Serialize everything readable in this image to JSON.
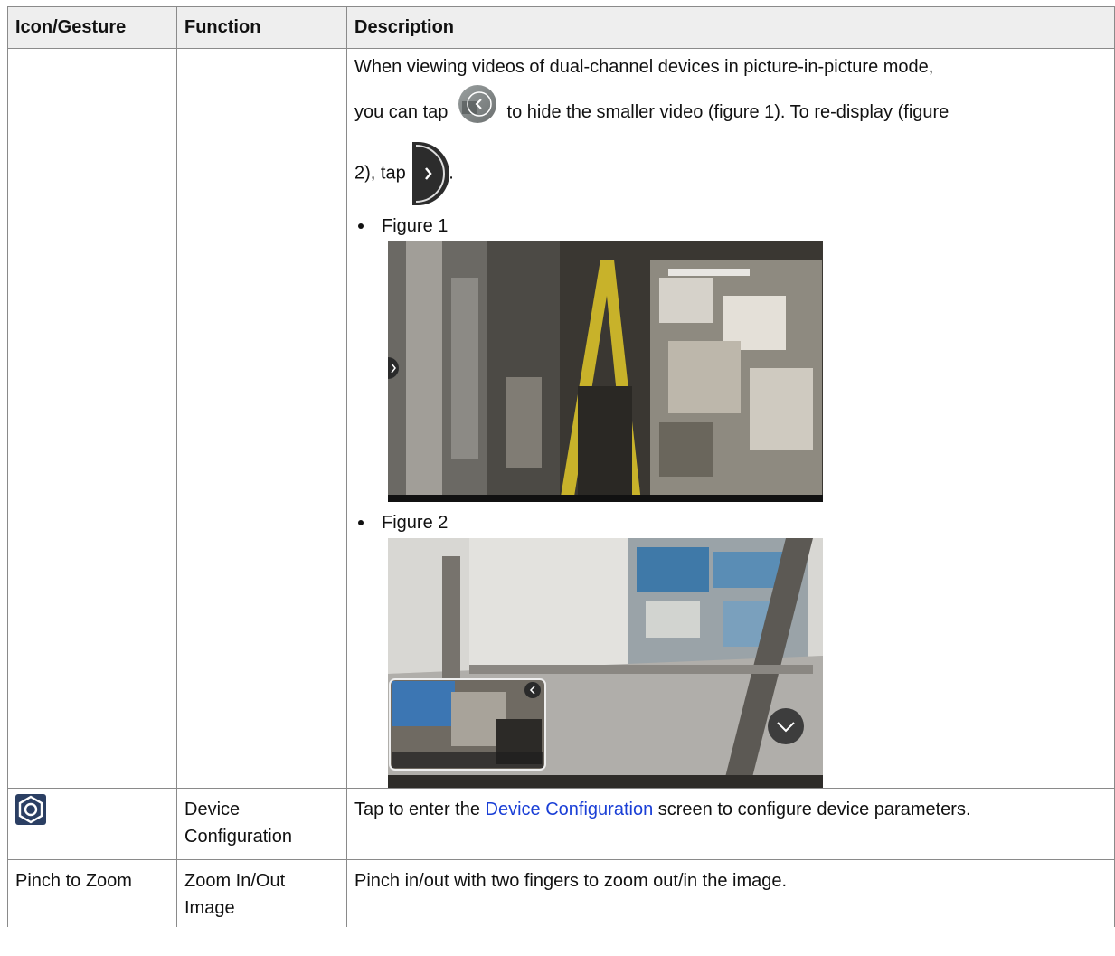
{
  "headers": {
    "col1": "Icon/Gesture",
    "col2": "Function",
    "col3": "Description"
  },
  "row_pip": {
    "desc_part1": "When viewing videos of dual-channel devices in picture-in-picture mode,",
    "desc_part2a": "you can tap",
    "desc_part2b": "to hide the smaller video (figure 1). To re-display (figure",
    "desc_part3a": "2), tap",
    "desc_part3b": ".",
    "figure1_label": "Figure 1",
    "figure2_label": "Figure 2"
  },
  "row_config": {
    "icon": "settings-hexagon-icon",
    "function": "Device Configuration",
    "desc_prefix": "Tap to enter the",
    "desc_link": "Device Configuration",
    "desc_suffix": "screen to configure device parameters."
  },
  "row_zoom": {
    "gesture": "Pinch to Zoom",
    "function": "Zoom In/Out Image",
    "description": "Pinch in/out with two fingers to zoom out/in the image."
  },
  "colors": {
    "link": "#1a3fd6",
    "header_bg": "#eeeeee",
    "border": "#8a8a8a"
  }
}
